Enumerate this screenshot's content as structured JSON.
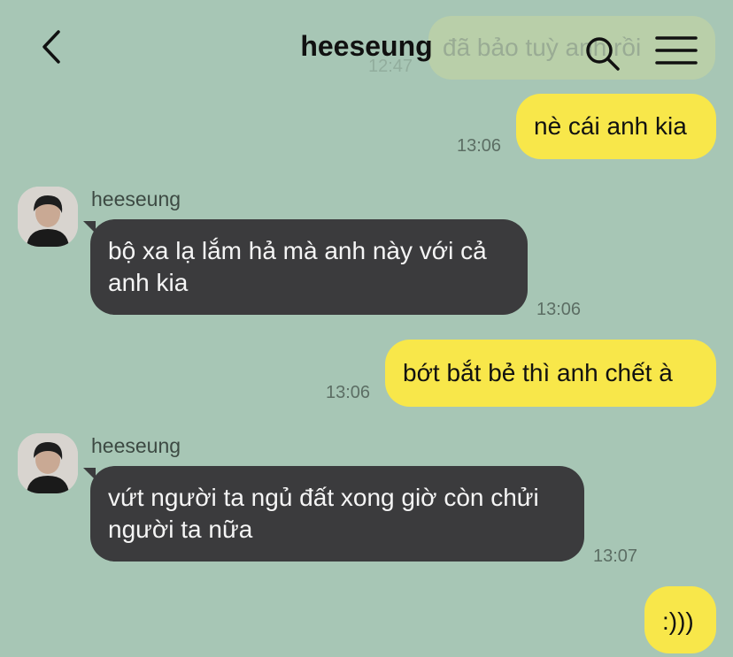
{
  "header": {
    "title": "heeseung",
    "back_icon": "chevron-left-icon",
    "search_icon": "search-icon",
    "menu_icon": "menu-icon"
  },
  "ghost_message": {
    "text": "đã bảo tuỳ anh rồi",
    "time": "12:47"
  },
  "messages": [
    {
      "side": "out",
      "text": "nè cái anh kia",
      "time": "13:06"
    },
    {
      "side": "in",
      "sender": "heeseung",
      "text": "bộ xa lạ lắm hả mà anh này với cả anh kia",
      "time": "13:06"
    },
    {
      "side": "out",
      "text": "bớt bắt bẻ thì anh chết à",
      "time": "13:06"
    },
    {
      "side": "in",
      "sender": "heeseung",
      "text": "vứt người ta ngủ đất xong giờ còn chửi người ta nữa",
      "time": "13:07"
    },
    {
      "side": "out",
      "text": ":)))"
    }
  ],
  "colors": {
    "background": "#a7c6b5",
    "outgoing_bubble": "#f8e74a",
    "incoming_bubble": "#3b3b3d"
  }
}
